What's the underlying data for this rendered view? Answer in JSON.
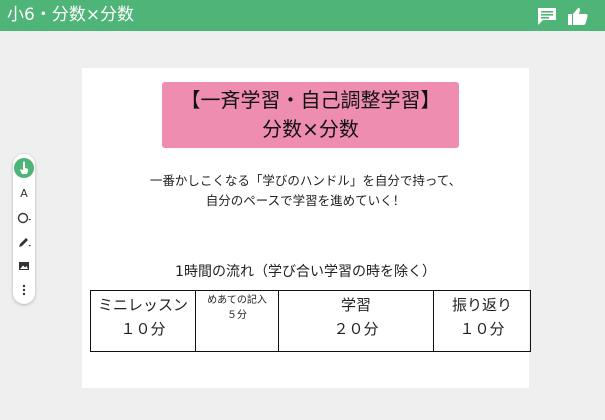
{
  "topbar": {
    "title": "小6・分数×分数",
    "icons": [
      "comment-icon",
      "thumbs-up-icon"
    ],
    "color": "#4fb477"
  },
  "slide": {
    "banner": {
      "line1": "【一斉学習・自己調整学習】",
      "line2": "分数×分数",
      "color": "#ee8daf"
    },
    "description": {
      "line1": "一番かしこくなる「学びのハンドル」を自分で持って、",
      "line2": "自分のペースで学習を進めていく！"
    },
    "flow_title": "1時間の流れ（学び合い学習の時を除く）",
    "flow_table": [
      {
        "label": "ミニレッスン",
        "time": "１０分"
      },
      {
        "label": "めあての記入",
        "time": "５分"
      },
      {
        "label": "学習",
        "time": "２０分"
      },
      {
        "label": "振り返り",
        "time": "１０分"
      }
    ]
  },
  "toolbar": {
    "tools": [
      "pointer-hand-icon",
      "text-tool-icon",
      "shape-tool-icon",
      "pen-tool-icon",
      "image-tool-icon",
      "more-options-icon"
    ],
    "text_tool_glyph": "A",
    "active_color": "#4fb477"
  }
}
